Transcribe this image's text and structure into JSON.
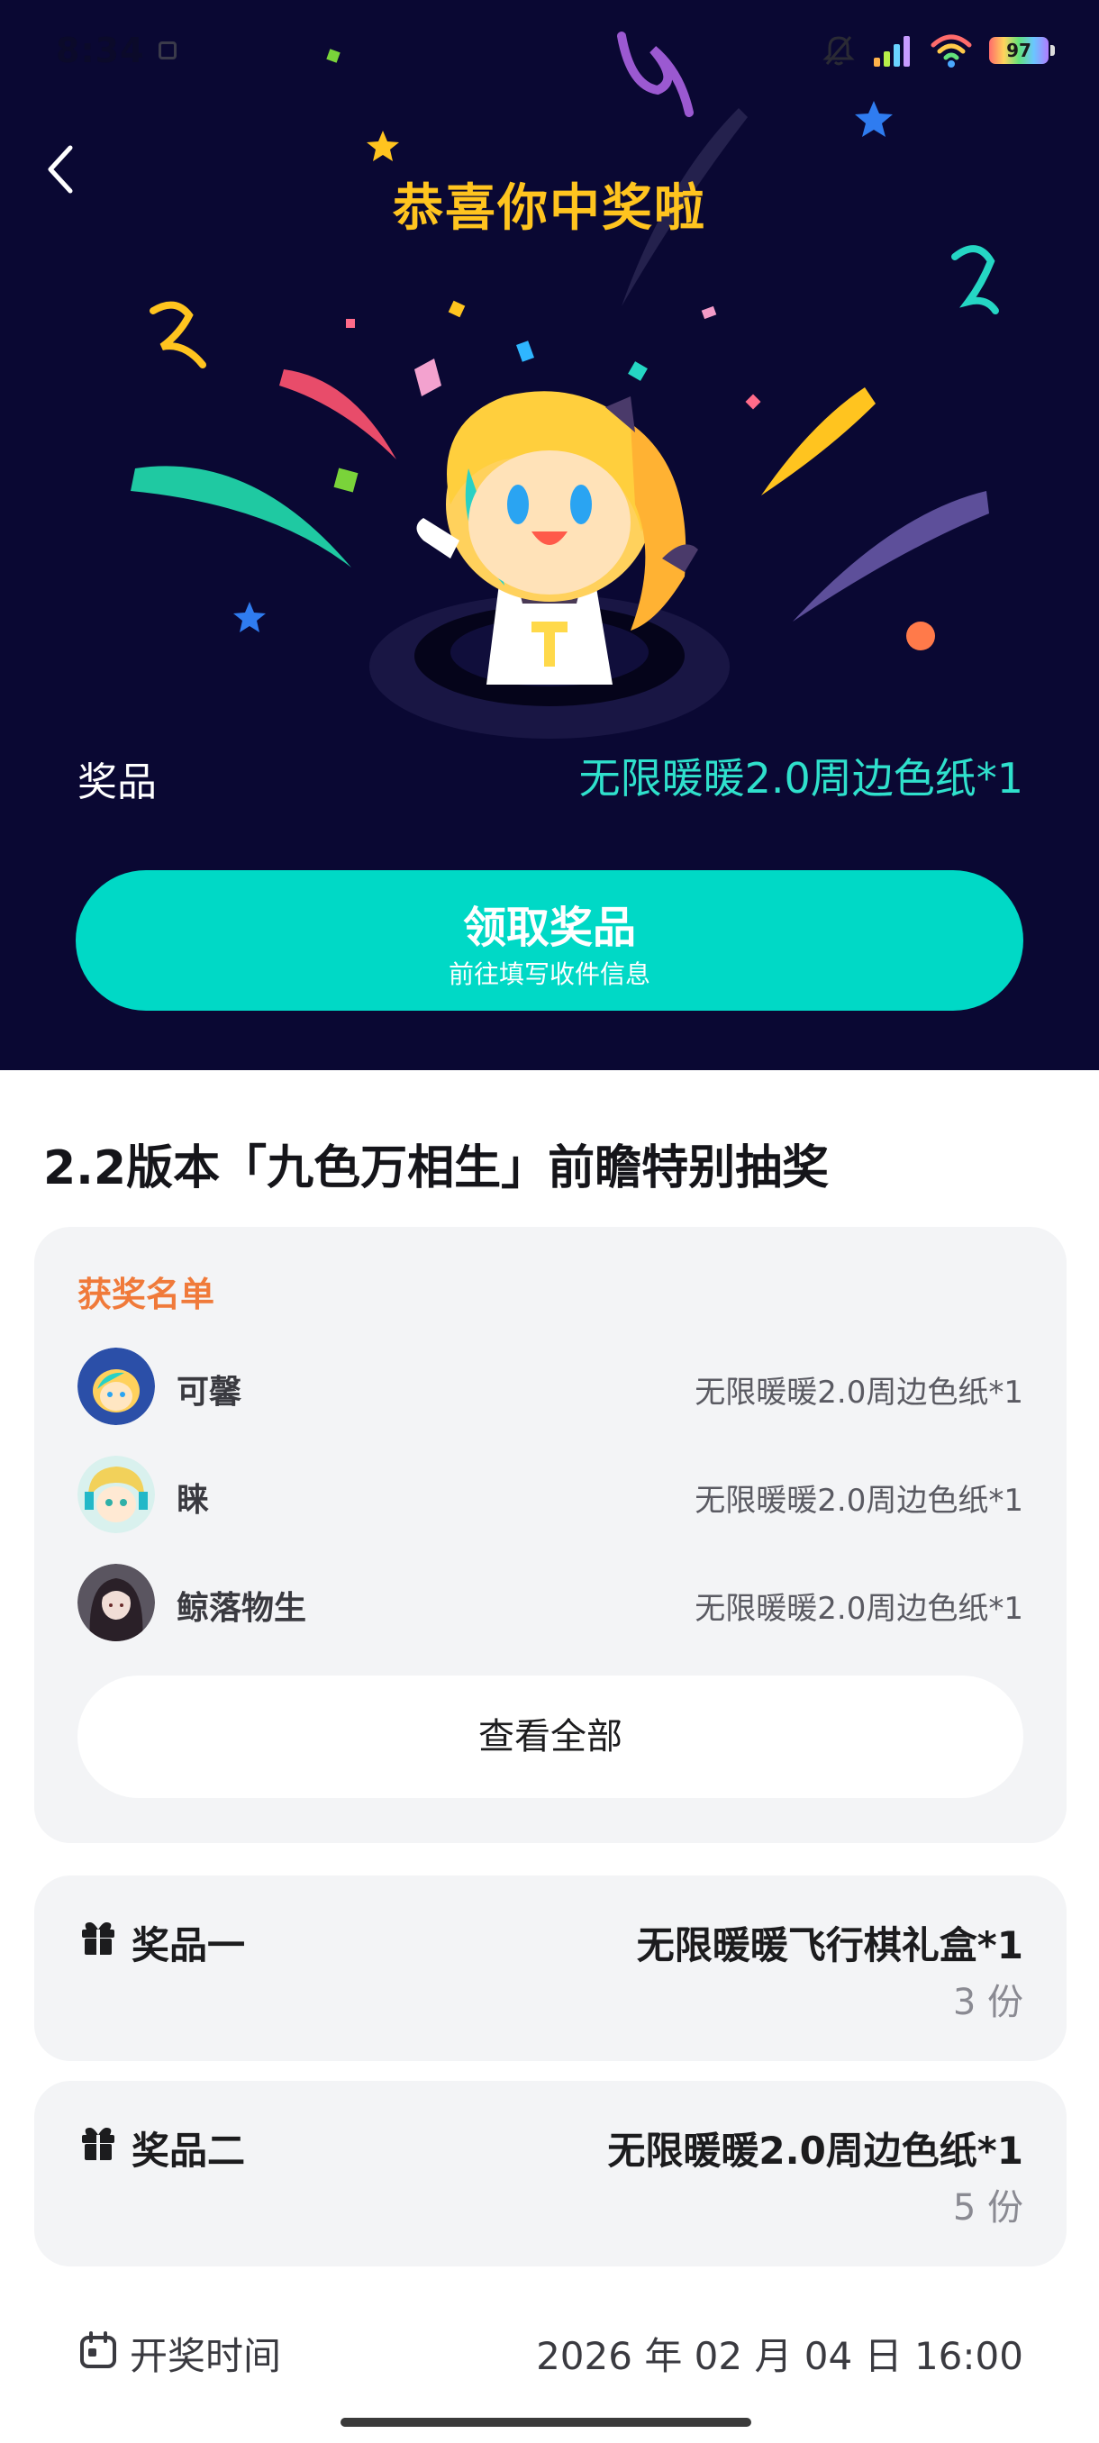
{
  "status_bar": {
    "time": "8:34",
    "battery": "97"
  },
  "hero": {
    "title": "恭喜你中奖啦",
    "prize_label": "奖品",
    "prize_value": "无限暖暖2.0周边色纸*1",
    "claim_button": {
      "label": "领取奖品",
      "sub_label": "前往填写收件信息"
    }
  },
  "lottery": {
    "title": "2.2版本「九色万相生」前瞻特别抽奖",
    "winners": {
      "heading": "获奖名单",
      "rows": [
        {
          "name": "可馨",
          "prize": "无限暖暖2.0周边色纸*1"
        },
        {
          "name": "睐",
          "prize": "无限暖暖2.0周边色纸*1"
        },
        {
          "name": "鲸落物生",
          "prize": "无限暖暖2.0周边色纸*1"
        }
      ],
      "view_all": "查看全部"
    },
    "prizes": [
      {
        "label": "奖品一",
        "name": "无限暖暖飞行棋礼盒*1",
        "count": "3 份"
      },
      {
        "label": "奖品二",
        "name": "无限暖暖2.0周边色纸*1",
        "count": "5 份"
      }
    ],
    "draw_time": {
      "label": "开奖时间",
      "value": "2026 年 02 月 04 日 16:00"
    }
  },
  "colors": {
    "hero_bg": "#0a0833",
    "title_gold": "#ffc41f",
    "prize_cyan": "#2fe0cc",
    "button_teal": "#00d9c6",
    "winners_orange": "#f07a3a"
  }
}
